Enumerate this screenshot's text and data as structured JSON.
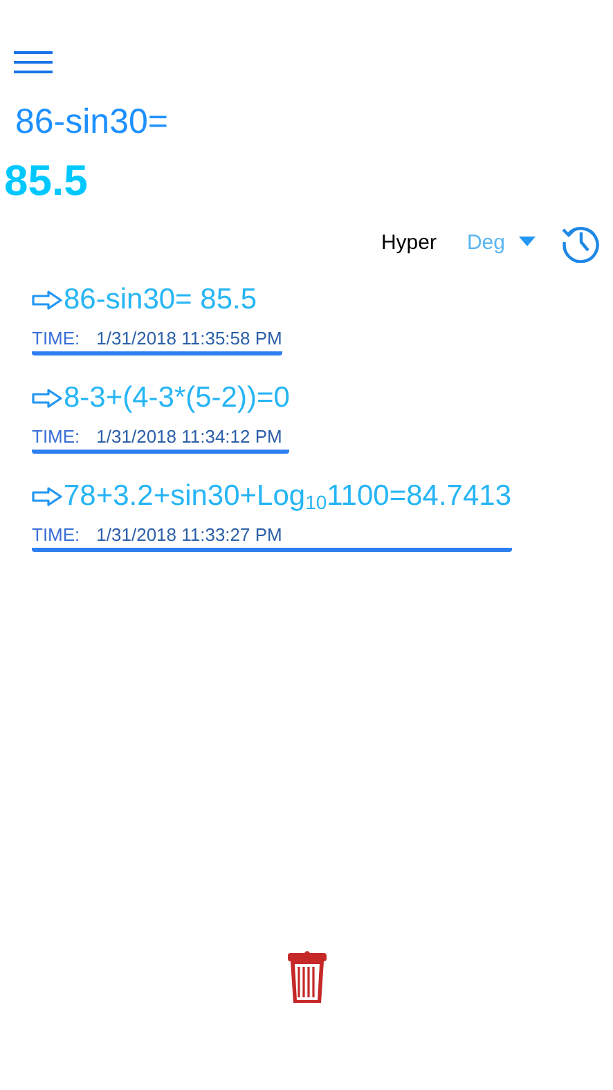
{
  "expression": "86-sin30=",
  "result": "85.5",
  "toolbar": {
    "hyper": "Hyper",
    "angle_mode": "Deg"
  },
  "history": [
    {
      "expression": "86-sin30= 85.5",
      "time_label": "TIME:",
      "time": "1/31/2018 11:35:58 PM"
    },
    {
      "expression": "8-3+(4-3*(5-2))=0",
      "time_label": "TIME:",
      "time": "1/31/2018 11:34:12 PM"
    },
    {
      "expression": "78+3.2+sin30+Log$_{10}$1100=84.7413",
      "time_label": "TIME:",
      "time": "1/31/2018 11:33:27 PM"
    }
  ]
}
